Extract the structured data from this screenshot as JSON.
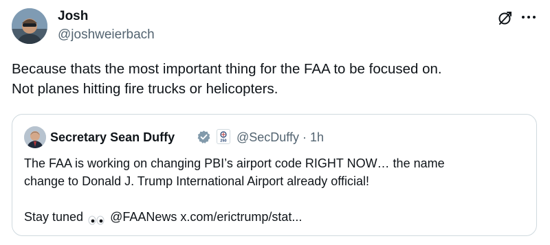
{
  "tweet": {
    "author_name": "Josh",
    "author_handle": "@joshweierbach",
    "text_lines": [
      "Because thats the most important thing for the FAA to be focused on.",
      "Not planes hitting fire trucks or helicopters."
    ]
  },
  "quoted": {
    "author_name": "Secretary Sean Duffy",
    "badge_text": "250",
    "handle_time": "@SecDuffy · 1h",
    "text_lines": [
      "The FAA is working on changing PBI’s airport code RIGHT NOW… the name",
      "change to Donald J. Trump International Airport already official!",
      ""
    ],
    "line_last_before": "Stay tuned",
    "line_last_after": "@FAANews x.com/erictrump/stat..."
  },
  "colors": {
    "text": "#0f1419",
    "secondary": "#536471",
    "border": "#cfd9de",
    "verified": "#829aab"
  },
  "icons": [
    "grok-icon",
    "more-icon",
    "verified-icon",
    "eyes-icon"
  ]
}
